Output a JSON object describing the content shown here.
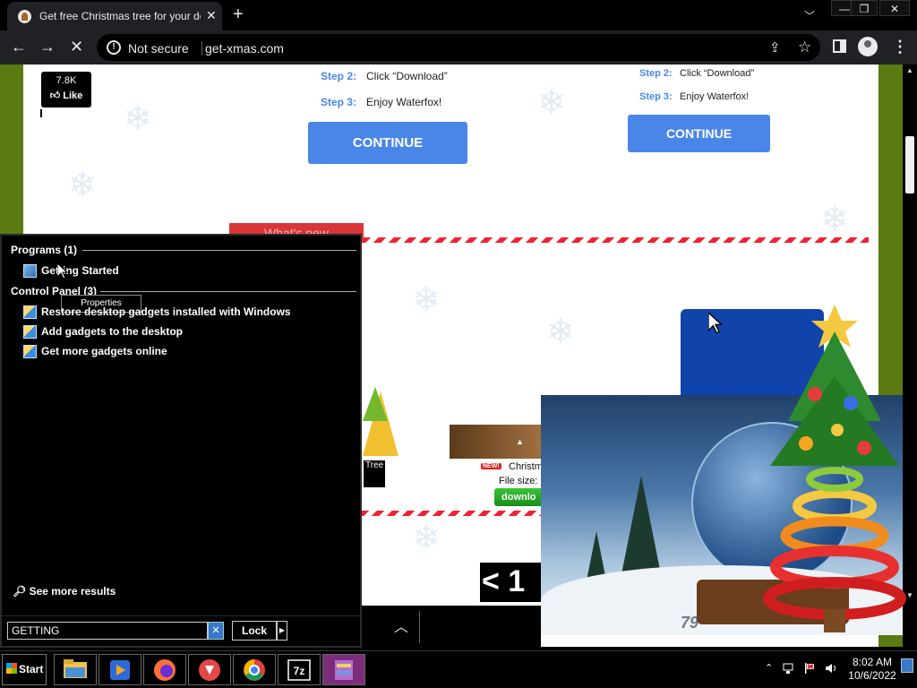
{
  "browser": {
    "tab_title": "Get free Christmas tree for your des",
    "security_label": "Not secure",
    "url": "get-xmas.com"
  },
  "page": {
    "like_count": "7.8K",
    "like_label": "Like",
    "left_steps": [
      {
        "label": "Step 2:",
        "text": "Click “Download”"
      },
      {
        "label": "Step 3:",
        "text": "Enjoy Waterfox!"
      }
    ],
    "right_steps": [
      {
        "label": "Step 2:",
        "text": "Click “Download”"
      },
      {
        "label": "Step 3:",
        "text": "Enjoy Waterfox!"
      }
    ],
    "continue_label": "CONTINUE",
    "whats_new": "What's new",
    "tree_label": "Tree",
    "new_badge": "NEW!",
    "xmas_title": "Christm",
    "file_size": "File size:",
    "download_label": "downlo",
    "pager": "< 1"
  },
  "gadget": {
    "counter": "79"
  },
  "start_menu": {
    "programs_header": "Programs (1)",
    "program_item": "Getting Started",
    "control_panel_header": "Control Panel (3)",
    "tooltip": "Properties",
    "cp_items": [
      "Restore desktop gadgets installed with Windows",
      "Add gadgets to the desktop",
      "Get more gadgets online"
    ],
    "see_more": "See more results",
    "search_value": "GETTING",
    "lock_label": "Lock"
  },
  "taskbar": {
    "start_label": "Start",
    "apps": [
      "file-explorer",
      "media-player",
      "firefox",
      "download-manager",
      "chrome",
      "7zip",
      "winrar"
    ],
    "time": "8:02 AM",
    "date": "10/6/2022"
  },
  "colors": {
    "accent_blue": "#4a86e8",
    "page_frame_green": "#5a7a12",
    "candy_red": "#e22233",
    "taskbar_active": "#7b2c7b"
  }
}
